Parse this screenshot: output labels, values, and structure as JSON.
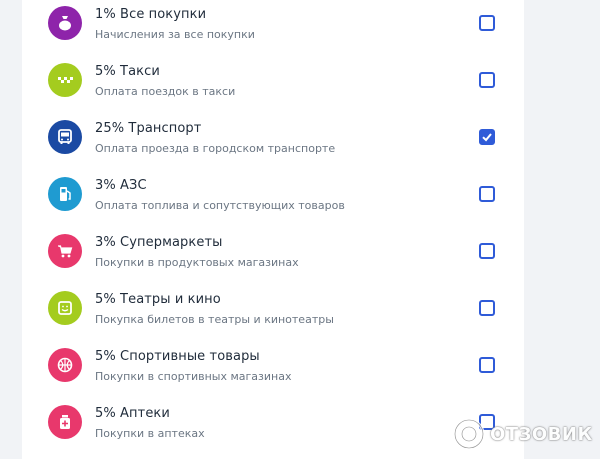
{
  "colors": {
    "accent": "#2f5bd8",
    "icon_purple": "#8e24aa",
    "icon_lime": "#a4cc1f",
    "icon_navy": "#1b4aa3",
    "icon_teal": "#1f9bd1",
    "icon_pink": "#e8386c"
  },
  "categories": [
    {
      "title": "1% Все покупки",
      "subtitle": "Начисления за все покупки",
      "icon": "money-bag-icon",
      "color": "#8e24aa",
      "checked": false
    },
    {
      "title": "5% Такси",
      "subtitle": "Оплата поездок в такси",
      "icon": "taxi-checker-icon",
      "color": "#a4cc1f",
      "checked": false
    },
    {
      "title": "25% Транспорт",
      "subtitle": "Оплата проезда в городском транспорте",
      "icon": "bus-icon",
      "color": "#1b4aa3",
      "checked": true
    },
    {
      "title": "3% АЗС",
      "subtitle": "Оплата топлива и сопутствующих товаров",
      "icon": "fuel-pump-icon",
      "color": "#1f9bd1",
      "checked": false
    },
    {
      "title": "3% Супермаркеты",
      "subtitle": "Покупки в продуктовых магазинах",
      "icon": "shopping-cart-icon",
      "color": "#e8386c",
      "checked": false
    },
    {
      "title": "5% Театры и кино",
      "subtitle": "Покупка билетов в театры и кинотеатры",
      "icon": "ticket-smile-icon",
      "color": "#a4cc1f",
      "checked": false
    },
    {
      "title": "5% Спортивные товары",
      "subtitle": "Покупки в спортивных магазинах",
      "icon": "ball-icon",
      "color": "#e8386c",
      "checked": false
    },
    {
      "title": "5% Аптеки",
      "subtitle": "Покупки в аптеках",
      "icon": "medicine-bottle-icon",
      "color": "#e8386c",
      "checked": false
    }
  ],
  "watermark": {
    "text": "ОТЗОВИК"
  }
}
